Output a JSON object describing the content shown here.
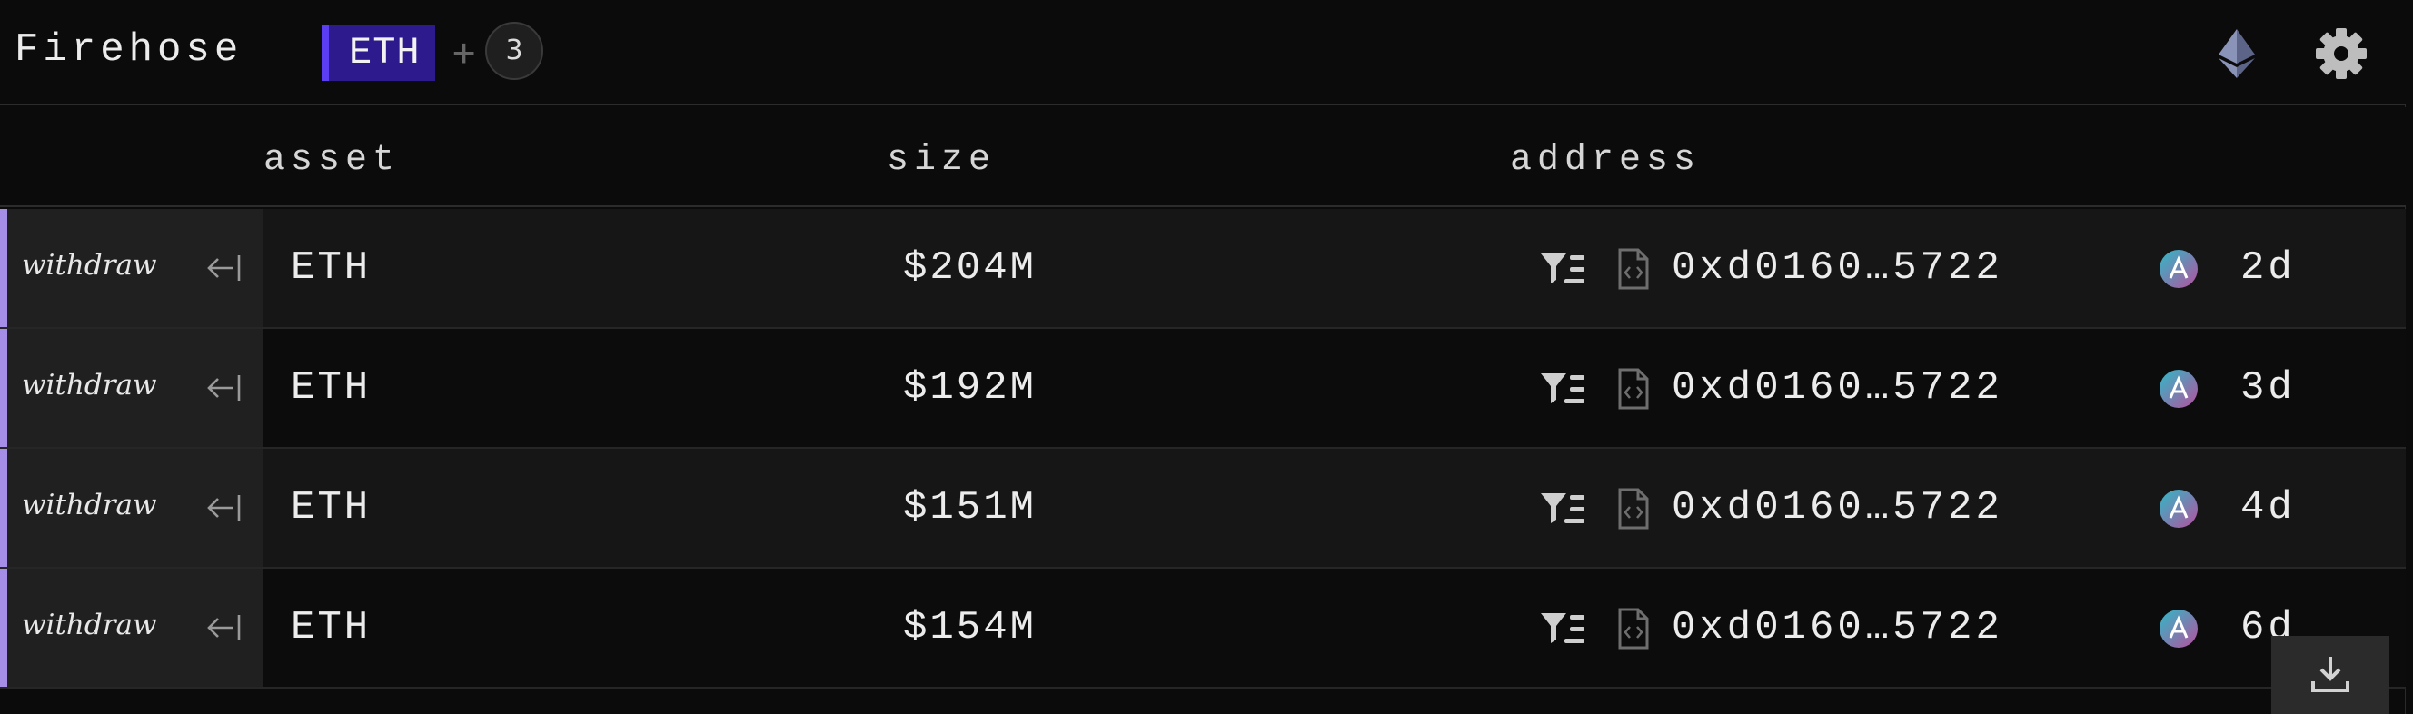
{
  "header": {
    "title": "Firehose",
    "filter_chip": "ETH",
    "add_symbol": "+",
    "filter_count": "3",
    "chain_icon": "ethereum-icon",
    "settings_icon": "gear-icon"
  },
  "columns": {
    "asset": "asset",
    "size": "size",
    "address": "address"
  },
  "rows": [
    {
      "type": "withdraw",
      "asset": "ETH",
      "size": "$204M",
      "address": "0xd0160…5722",
      "age": "2d",
      "protocol_icon": "aave-icon"
    },
    {
      "type": "withdraw",
      "asset": "ETH",
      "size": "$192M",
      "address": "0xd0160…5722",
      "age": "3d",
      "protocol_icon": "aave-icon"
    },
    {
      "type": "withdraw",
      "asset": "ETH",
      "size": "$151M",
      "address": "0xd0160…5722",
      "age": "4d",
      "protocol_icon": "aave-icon"
    },
    {
      "type": "withdraw",
      "asset": "ETH",
      "size": "$154M",
      "address": "0xd0160…5722",
      "age": "6d",
      "protocol_icon": "aave-icon"
    }
  ],
  "colors": {
    "background": "#0b0b0b",
    "chip_bg": "#2d1a8c",
    "chip_accent": "#5b3df2",
    "row_accent": "#a58ee8",
    "aave_gradient_start": "#2ebac6",
    "aave_gradient_end": "#b6509e"
  },
  "footer": {
    "download_icon": "download-icon"
  }
}
